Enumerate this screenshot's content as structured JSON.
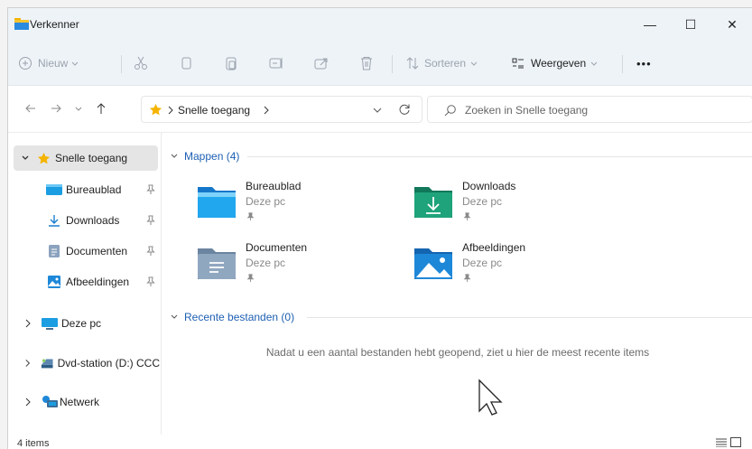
{
  "window": {
    "title": "Verkenner"
  },
  "titlebar": {
    "minimize": "—",
    "maximize": "☐",
    "close": "✕"
  },
  "commandbar": {
    "new_label": "Nieuw",
    "sort_label": "Sorteren",
    "view_label": "Weergeven",
    "more_label": "•••"
  },
  "address": {
    "path_label": "Snelle toegang",
    "search_placeholder": "Zoeken in Snelle toegang"
  },
  "sidebar": {
    "quick_access": "Snelle toegang",
    "items": [
      {
        "label": "Bureaublad",
        "icon": "desktop-icon"
      },
      {
        "label": "Downloads",
        "icon": "download-icon"
      },
      {
        "label": "Documenten",
        "icon": "document-icon"
      },
      {
        "label": "Afbeeldingen",
        "icon": "picture-icon"
      }
    ],
    "this_pc": "Deze pc",
    "dvd": "Dvd-station (D:) CCC",
    "network": "Netwerk"
  },
  "main": {
    "folders_header": "Mappen (4)",
    "folders": [
      {
        "name": "Bureaublad",
        "location": "Deze pc"
      },
      {
        "name": "Downloads",
        "location": "Deze pc"
      },
      {
        "name": "Documenten",
        "location": "Deze pc"
      },
      {
        "name": "Afbeeldingen",
        "location": "Deze pc"
      }
    ],
    "recent_header": "Recente bestanden (0)",
    "recent_empty": "Nadat u een aantal bestanden hebt geopend, ziet u hier de meest recente items"
  },
  "status": {
    "count": "4 items"
  },
  "colors": {
    "accent": "#1d5fb3",
    "folder_blue": "#1e88d8",
    "folder_green": "#1fa37a",
    "star": "#f5b400"
  }
}
